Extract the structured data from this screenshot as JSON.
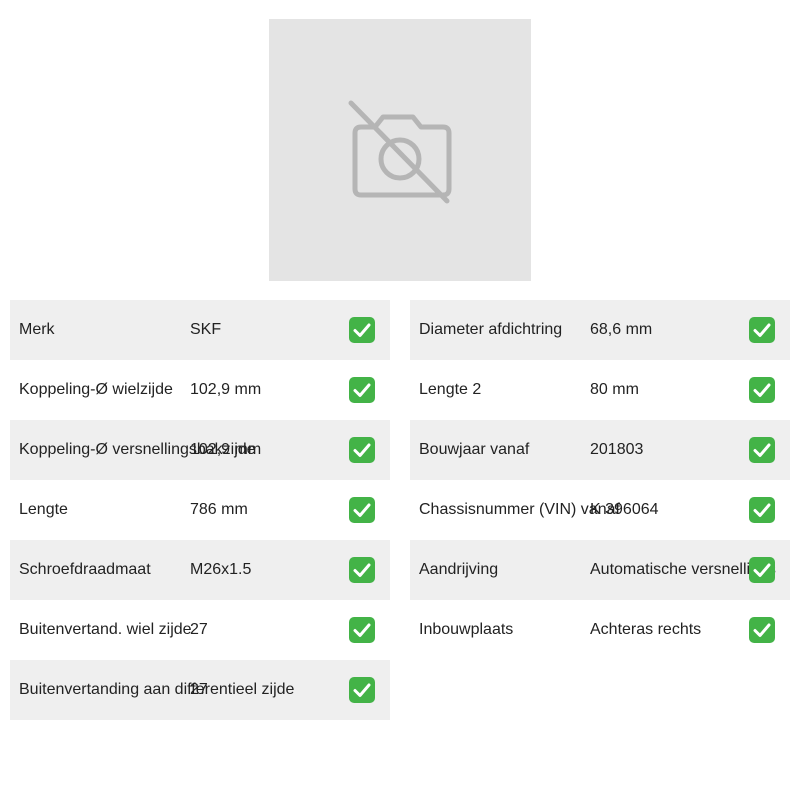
{
  "product_image": {
    "icon": "no-photo-camera-icon"
  },
  "specs_left": [
    {
      "label": "Merk",
      "value": "SKF"
    },
    {
      "label": "Koppeling-Ø wielzijde",
      "value": "102,9 mm"
    },
    {
      "label": "Koppeling-Ø versnellingsbakzijde",
      "value": "102,9 mm"
    },
    {
      "label": "Lengte",
      "value": "786 mm"
    },
    {
      "label": "Schroefdraadmaat",
      "value": "M26x1.5"
    },
    {
      "label": "Buitenvertand. wiel zijde",
      "value": "27"
    },
    {
      "label": "Buitenvertanding aan differentieel zijde",
      "value": "27"
    }
  ],
  "specs_right": [
    {
      "label": "Diameter afdichtring",
      "value": "68,6 mm"
    },
    {
      "label": "Lengte 2",
      "value": "80 mm"
    },
    {
      "label": "Bouwjaar vanaf",
      "value": "201803"
    },
    {
      "label": "Chassisnummer (VIN) vanaf",
      "value": "K 396064"
    },
    {
      "label": "Aandrijving",
      "value": "Automatische versnellings"
    },
    {
      "label": "Inbouwplaats",
      "value": "Achteras rechts"
    }
  ],
  "colors": {
    "check_green": "#43b347",
    "row_shade": "#efefef",
    "image_placeholder": "#e4e4e4"
  }
}
